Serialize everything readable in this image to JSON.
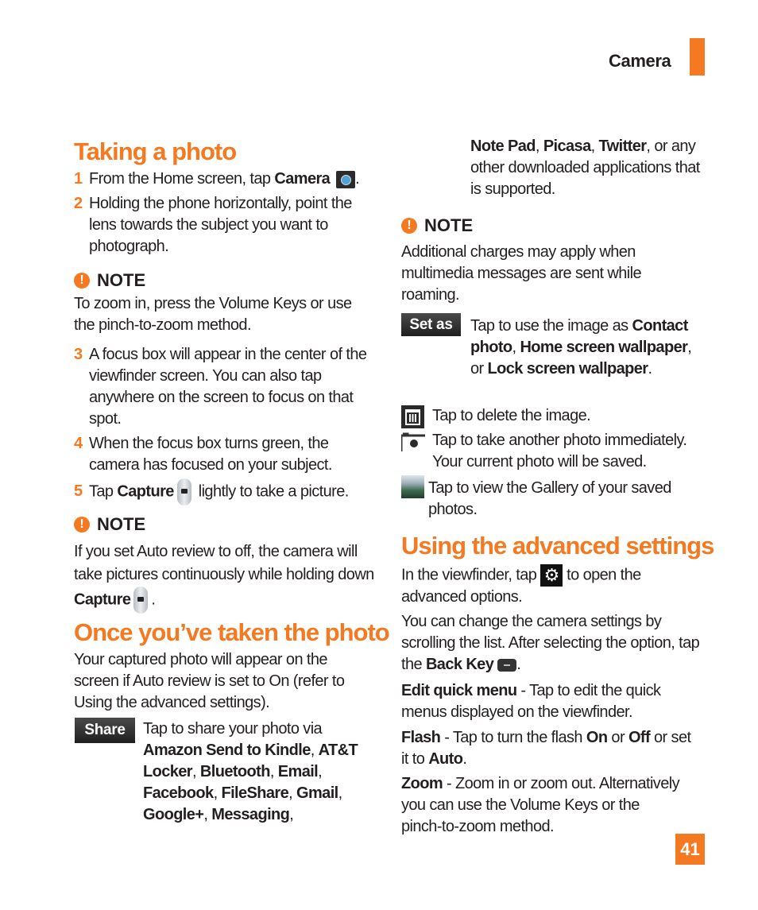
{
  "header": {
    "section": "Camera",
    "accent": "#f47920"
  },
  "page_number": "41",
  "colors": {
    "accent": "#f47920",
    "text": "#231f20",
    "label_bg": "#2a2a2a"
  },
  "taking_photo": {
    "title": "Taking a photo",
    "steps": [
      {
        "num": "1",
        "pre": "From the Home screen, tap ",
        "bold": "Camera",
        "post": ".",
        "icon": "camera-app-icon"
      },
      {
        "num": "2",
        "text": "Holding the phone horizontally, point the lens towards the subject you want to photograph."
      },
      {
        "num": "3",
        "text": "A focus box will appear in the center of the viewfinder screen. You can also tap anywhere on the screen to focus on that spot."
      },
      {
        "num": "4",
        "text": "When the focus box turns green, the camera has focused on your subject."
      },
      {
        "num": "5",
        "pre": "Tap ",
        "bold": "Capture",
        "post": " lightly to take a picture.",
        "icon": "capture-button-icon"
      }
    ],
    "note1": {
      "title": "NOTE",
      "text": "To zoom in, press the Volume Keys or use the pinch-to-zoom method."
    },
    "note2": {
      "title": "NOTE",
      "pre": "If you set Auto review to off, the camera will take pictures continuously while holding down ",
      "bold": "Capture",
      "post": "."
    }
  },
  "once_taken": {
    "title": "Once you’ve taken the photo",
    "intro": "Your captured photo will appear on the screen if Auto review is set to On (refer to Using the advanced settings).",
    "share": {
      "label": "Share",
      "pre": "Tap to share your photo via ",
      "apps": [
        "Amazon Send to Kindle",
        "AT&T Locker",
        "Bluetooth",
        "Email",
        "Facebook",
        "FileShare",
        "Gmail",
        "Google+",
        "Messaging",
        "Note Pad",
        "Picasa",
        "Twitter"
      ],
      "post": ", or any other downloaded applications that is supported."
    },
    "note3": {
      "title": "NOTE",
      "text": "Additional charges may apply when multimedia messages are sent while roaming."
    },
    "set_as": {
      "label": "Set as",
      "pre": "Tap to use the image as ",
      "b1": "Contact photo",
      "s1": ", ",
      "b2": "Home screen wallpaper",
      "s2": ", or ",
      "b3": "Lock screen wallpaper",
      "post": "."
    },
    "delete": {
      "icon": "trash-icon",
      "text": "Tap to delete the image."
    },
    "camera": {
      "icon": "camera-icon",
      "text": "Tap to take another photo immediately. Your current photo will be saved."
    },
    "gallery": {
      "icon": "gallery-thumbnail-icon",
      "text": "Tap to view the Gallery of your saved photos."
    }
  },
  "advanced": {
    "title": "Using the advanced settings",
    "p1_pre": "In the viewfinder, tap ",
    "p1_post": " to open the advanced options.",
    "p2_pre": "You can change the camera settings by scrolling the list. After selecting the option, tap the ",
    "p2_bold": "Back Key",
    "p2_post": ".",
    "items": [
      {
        "name": "Edit quick menu",
        "desc": " - Tap to edit the quick menus displayed on the viewfinder."
      },
      {
        "name": "Flash",
        "desc_pre": " - Tap to turn the flash ",
        "on": "On",
        "or1": " or ",
        "off": "Off",
        "or2": " or set it to ",
        "auto": "Auto",
        "end": "."
      },
      {
        "name": "Zoom",
        "desc": " - Zoom in or zoom out. Alternatively you can use the Volume Keys or the pinch-to-zoom method."
      }
    ]
  }
}
